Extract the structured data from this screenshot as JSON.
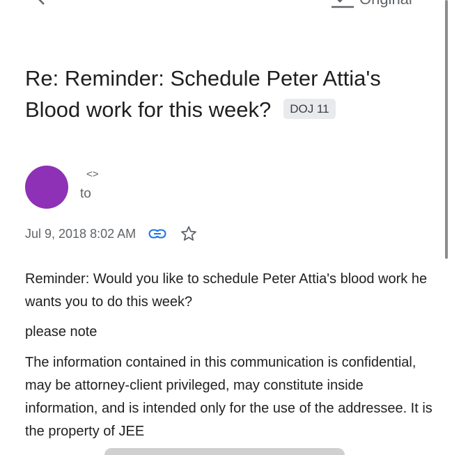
{
  "toolbar": {
    "back_icon": "chevron-left-icon",
    "original_icon": "translate-icon",
    "original_label": "Original"
  },
  "scrollbar_color": "#8c8c8c",
  "email": {
    "subject": "Re: Reminder: Schedule Peter Attia's Blood work for this week?",
    "label_chip": "DOJ 11",
    "avatar_color": "#8e31b6",
    "sender_email": "<>",
    "recipient_label": "to",
    "date": "Jul 9, 2018 8:02 AM",
    "link_icon": "link-icon",
    "star_icon": "star-outline-icon",
    "body": {
      "paragraph_1": "Reminder: Would you like to schedule Peter Attia's blood work he wants you to do this week?",
      "paragraph_2": "please note",
      "paragraph_3": "The information contained in this communication is confidential, may be attorney-client privileged, may constitute inside information, and is intended only for the use of the addressee. It is the property of JEE"
    }
  }
}
